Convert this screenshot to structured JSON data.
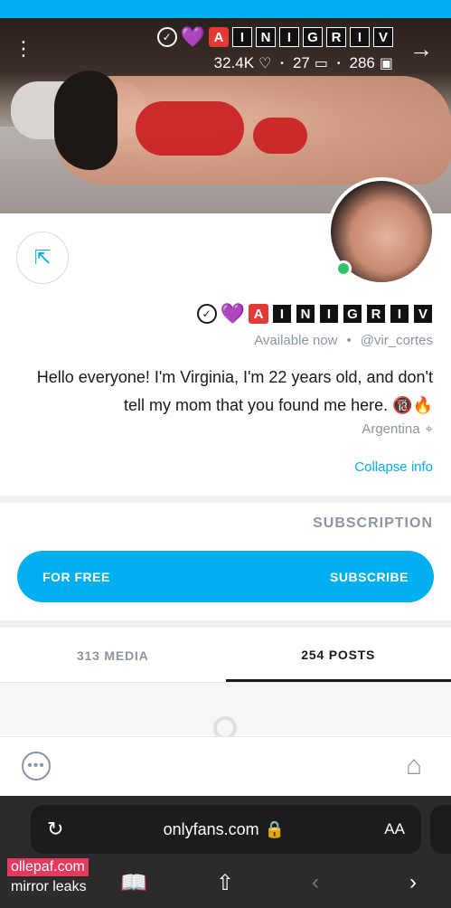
{
  "profile": {
    "name_letters": [
      "V",
      "I",
      "R",
      "G",
      "I",
      "N",
      "I",
      "A"
    ],
    "handle": "@vir_cortes",
    "availability": "Available now",
    "bio_line1": "Hello everyone! I'm Virginia, I'm 22 years old, and don't",
    "bio_line2": "tell my mom that you found me here. 🔞🔥",
    "location": "Argentina",
    "collapse_label": "Collapse info"
  },
  "stats": {
    "photos": "286",
    "videos": "27",
    "likes": "32.4K"
  },
  "subscription": {
    "section_title": "SUBSCRIPTION",
    "button_label": "SUBSCRIBE",
    "price_label": "FOR FREE"
  },
  "tabs": [
    {
      "label": "254 POSTS",
      "active": true
    },
    {
      "label": "313 MEDIA",
      "active": false
    }
  ],
  "browser": {
    "url": "onlyfans.com",
    "text_size_label": "AA"
  },
  "watermark": {
    "line1": "ollepaf.com",
    "line2": "mirror leaks"
  },
  "colors": {
    "accent": "#00aff0",
    "online": "#32c36b",
    "badge_red": "#e53935"
  }
}
